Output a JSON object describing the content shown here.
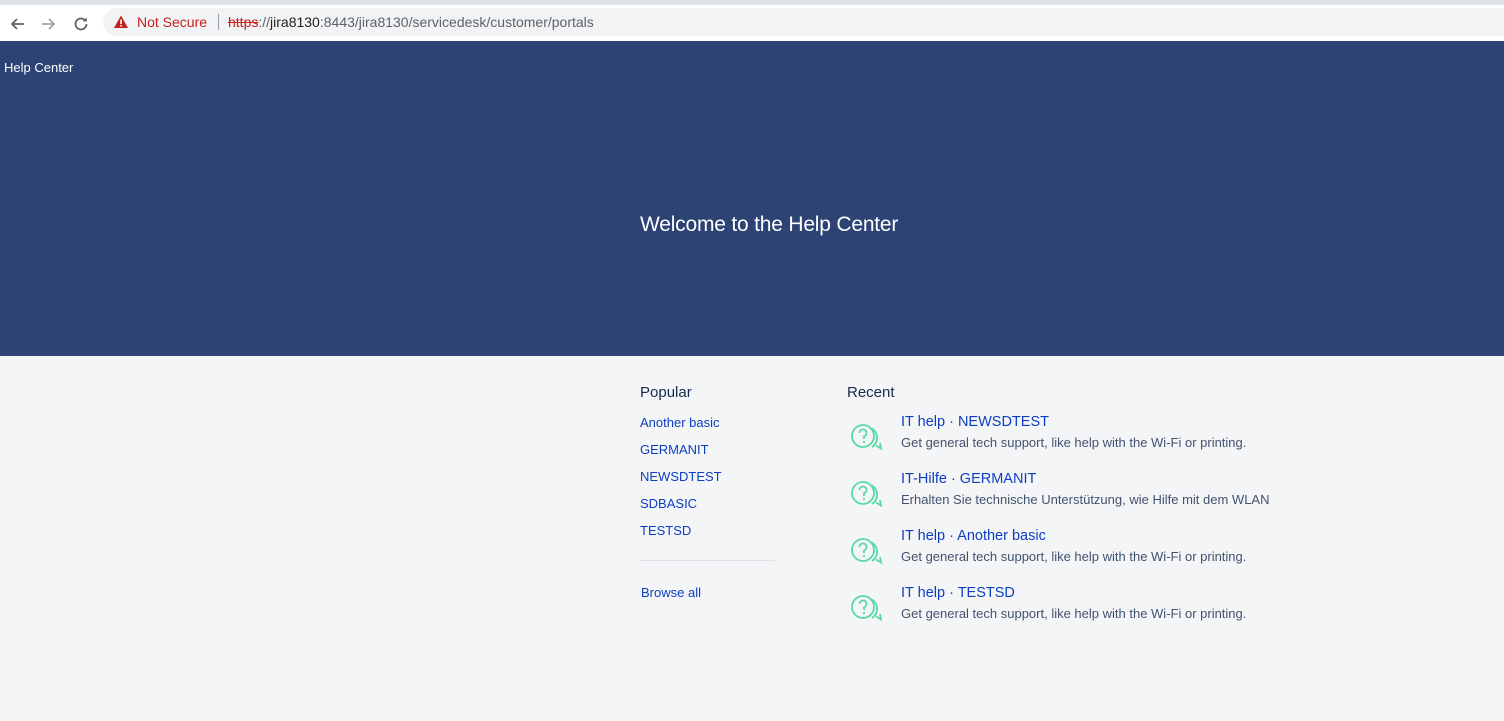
{
  "browser": {
    "security_label": "Not Secure",
    "url_scheme": "https",
    "url_sep": "://",
    "url_host": "jira8130",
    "url_rest": ":8443/jira8130/servicedesk/customer/portals"
  },
  "header": {
    "brand": "Help Center",
    "welcome": "Welcome to the Help Center"
  },
  "popular": {
    "title": "Popular",
    "items": [
      "Another basic",
      "GERMANIT",
      "NEWSDTEST",
      "SDBASIC",
      "TESTSD"
    ],
    "browse_all": "Browse all"
  },
  "recent": {
    "title": "Recent",
    "items": [
      {
        "title": "IT help · NEWSDTEST",
        "desc": "Get general tech support, like help with the Wi-Fi or printing."
      },
      {
        "title": "IT-Hilfe · GERMANIT",
        "desc": "Erhalten Sie technische Unterstützung, wie Hilfe mit dem WLAN"
      },
      {
        "title": "IT help · Another basic",
        "desc": "Get general tech support, like help with the Wi-Fi or printing."
      },
      {
        "title": "IT help · TESTSD",
        "desc": "Get general tech support, like help with the Wi-Fi or printing."
      }
    ]
  },
  "colors": {
    "header_bg": "#2c4374",
    "link": "#0d3ec2",
    "icon": "#57d9a3",
    "page_bg": "#f4f5f7"
  }
}
